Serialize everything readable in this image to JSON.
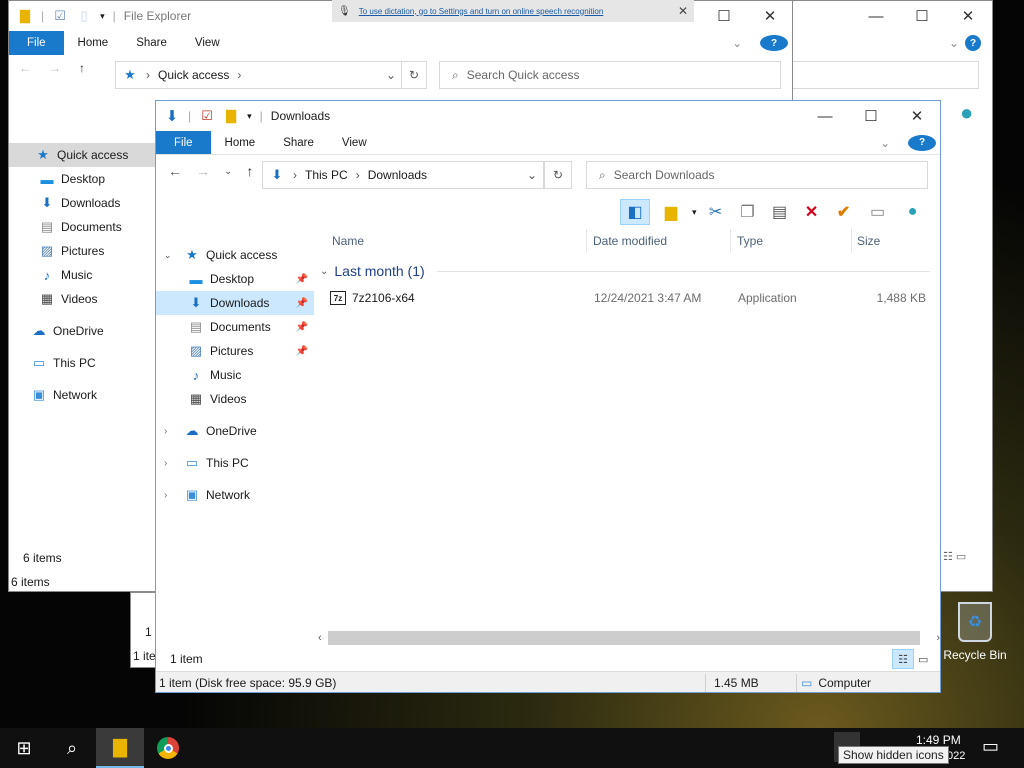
{
  "dictation_banner": "To use dictation, go to Settings and turn on online speech recognition",
  "back_window": {
    "title": "File Explorer",
    "tabs": [
      "File",
      "Home",
      "Share",
      "View"
    ],
    "address": "Quick access",
    "search_placeholder": "Search Quick access",
    "nav": [
      "Quick access",
      "Desktop",
      "Downloads",
      "Documents",
      "Pictures",
      "Music",
      "Videos",
      "OneDrive",
      "This PC",
      "Network"
    ],
    "status_inner": "6 items",
    "status_outer": "6 items"
  },
  "third_window": {
    "status_fragment": "1 ite",
    "status_fragment2": "1 i"
  },
  "front_window": {
    "title": "Downloads",
    "tabs": [
      "File",
      "Home",
      "Share",
      "View"
    ],
    "breadcrumb": [
      "This PC",
      "Downloads"
    ],
    "search_placeholder": "Search Downloads",
    "nav": {
      "quick_access": "Quick access",
      "items": [
        "Desktop",
        "Downloads",
        "Documents",
        "Pictures",
        "Music",
        "Videos"
      ],
      "onedrive": "OneDrive",
      "thispc": "This PC",
      "network": "Network"
    },
    "columns": [
      "Name",
      "Date modified",
      "Type",
      "Size"
    ],
    "group_label": "Last month (1)",
    "file": {
      "name": "7z2106-x64",
      "date": "12/24/2021 3:47 AM",
      "type": "Application",
      "size": "1,488 KB"
    },
    "status_count": "1 item",
    "status_bar": "1 item (Disk free space: 95.9 GB)",
    "status_size": "1.45 MB",
    "status_location": "Computer"
  },
  "desktop": {
    "recycle_bin": "Recycle Bin"
  },
  "taskbar": {
    "time": "1:49 PM",
    "date_fragment": "022",
    "tooltip": "Show hidden icons"
  },
  "colors": {
    "accent": "#1979ca",
    "selection": "#cce8ff",
    "taskbar": "#101010"
  }
}
